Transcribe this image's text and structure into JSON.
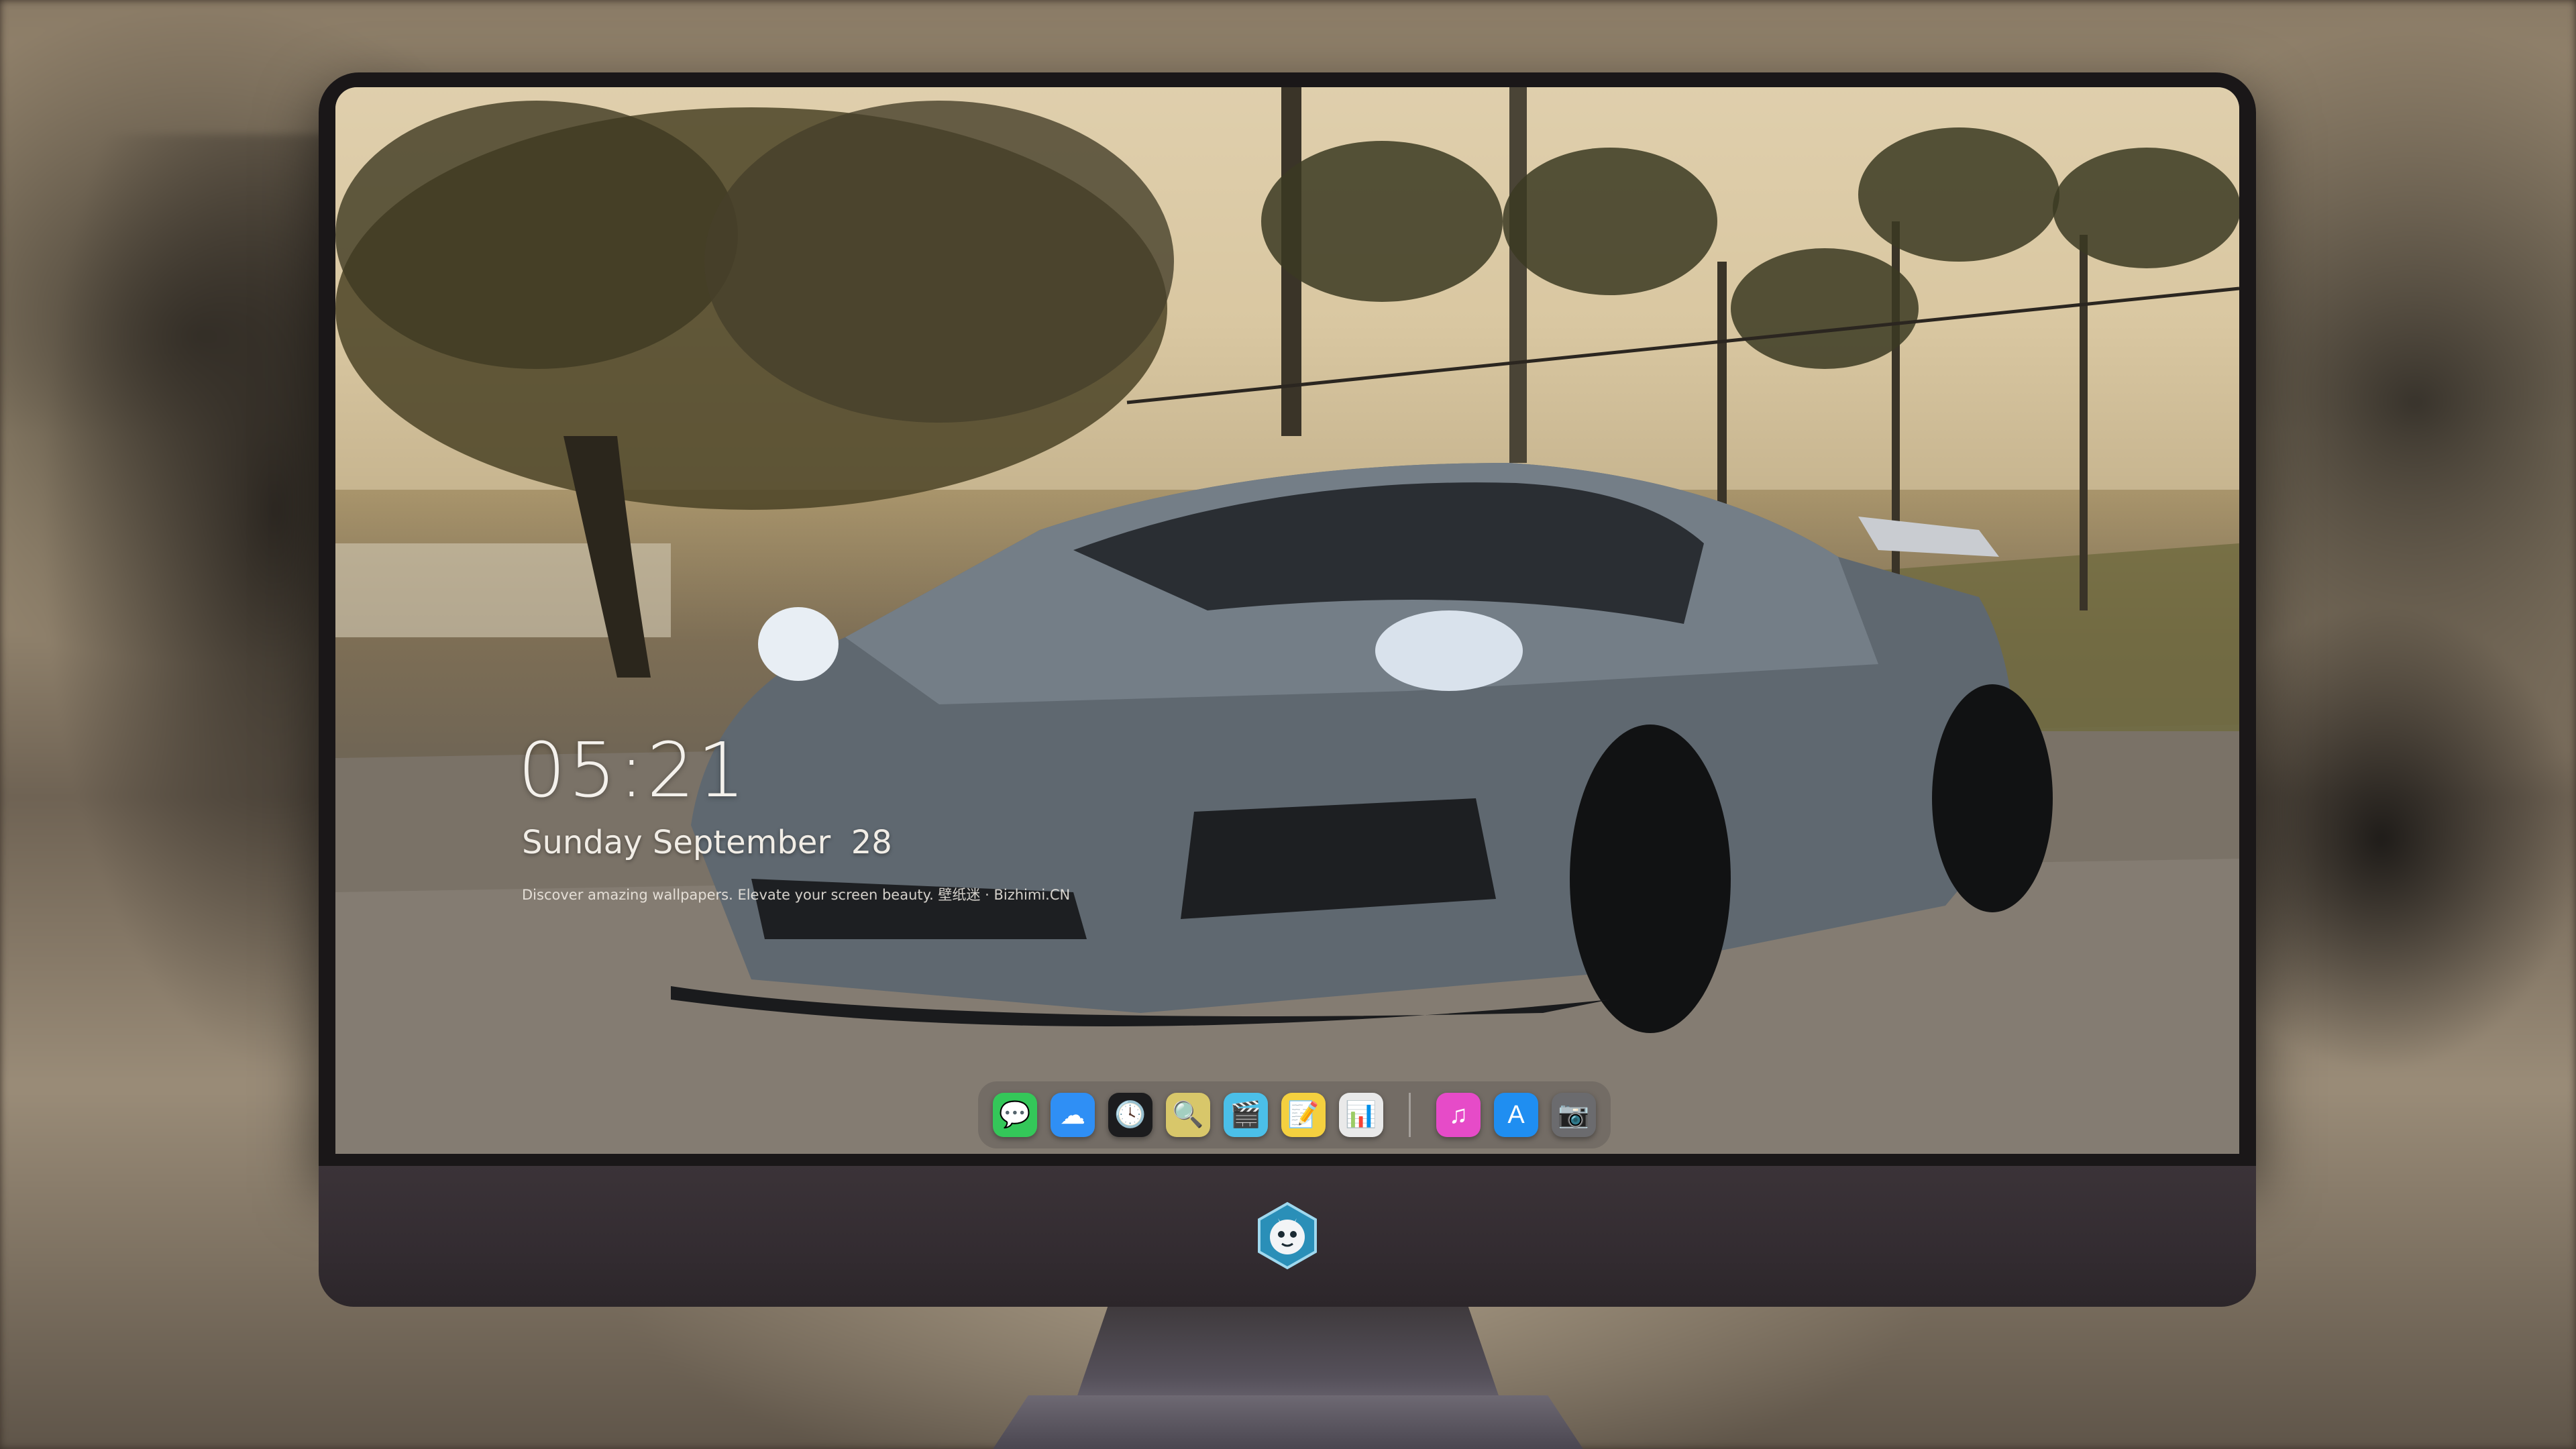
{
  "lock_screen": {
    "time": "05:21",
    "date": "Sunday September  28",
    "tagline": "Discover amazing wallpapers. Elevate your screen beauty. 壁纸迷 · Bizhimi.CN"
  },
  "dock": {
    "apps": [
      {
        "name": "messages-icon",
        "color": "#34c759",
        "glyph": "💬"
      },
      {
        "name": "weather-icon",
        "color": "#2f8ff5",
        "glyph": "☁"
      },
      {
        "name": "clock-icon",
        "color": "#1c1c1e",
        "glyph": "🕓"
      },
      {
        "name": "preview-icon",
        "color": "#d8c76a",
        "glyph": "🔍"
      },
      {
        "name": "clips-icon",
        "color": "#4bbfe8",
        "glyph": "🎬"
      },
      {
        "name": "notes-icon",
        "color": "#f4d03f",
        "glyph": "📝"
      },
      {
        "name": "photo-booth-icon",
        "color": "#e9e9e9",
        "glyph": "📊"
      }
    ],
    "apps_right": [
      {
        "name": "itunes-icon",
        "color": "#e64bc8",
        "glyph": "♫"
      },
      {
        "name": "app-store-icon",
        "color": "#1f8ef1",
        "glyph": "A"
      },
      {
        "name": "camera-icon",
        "color": "#6b6b6e",
        "glyph": "📷"
      }
    ]
  },
  "colors": {
    "monitor_bezel": "#1a1718",
    "monitor_chin": "#3b3338",
    "clock_text": "#f4f1ec"
  }
}
